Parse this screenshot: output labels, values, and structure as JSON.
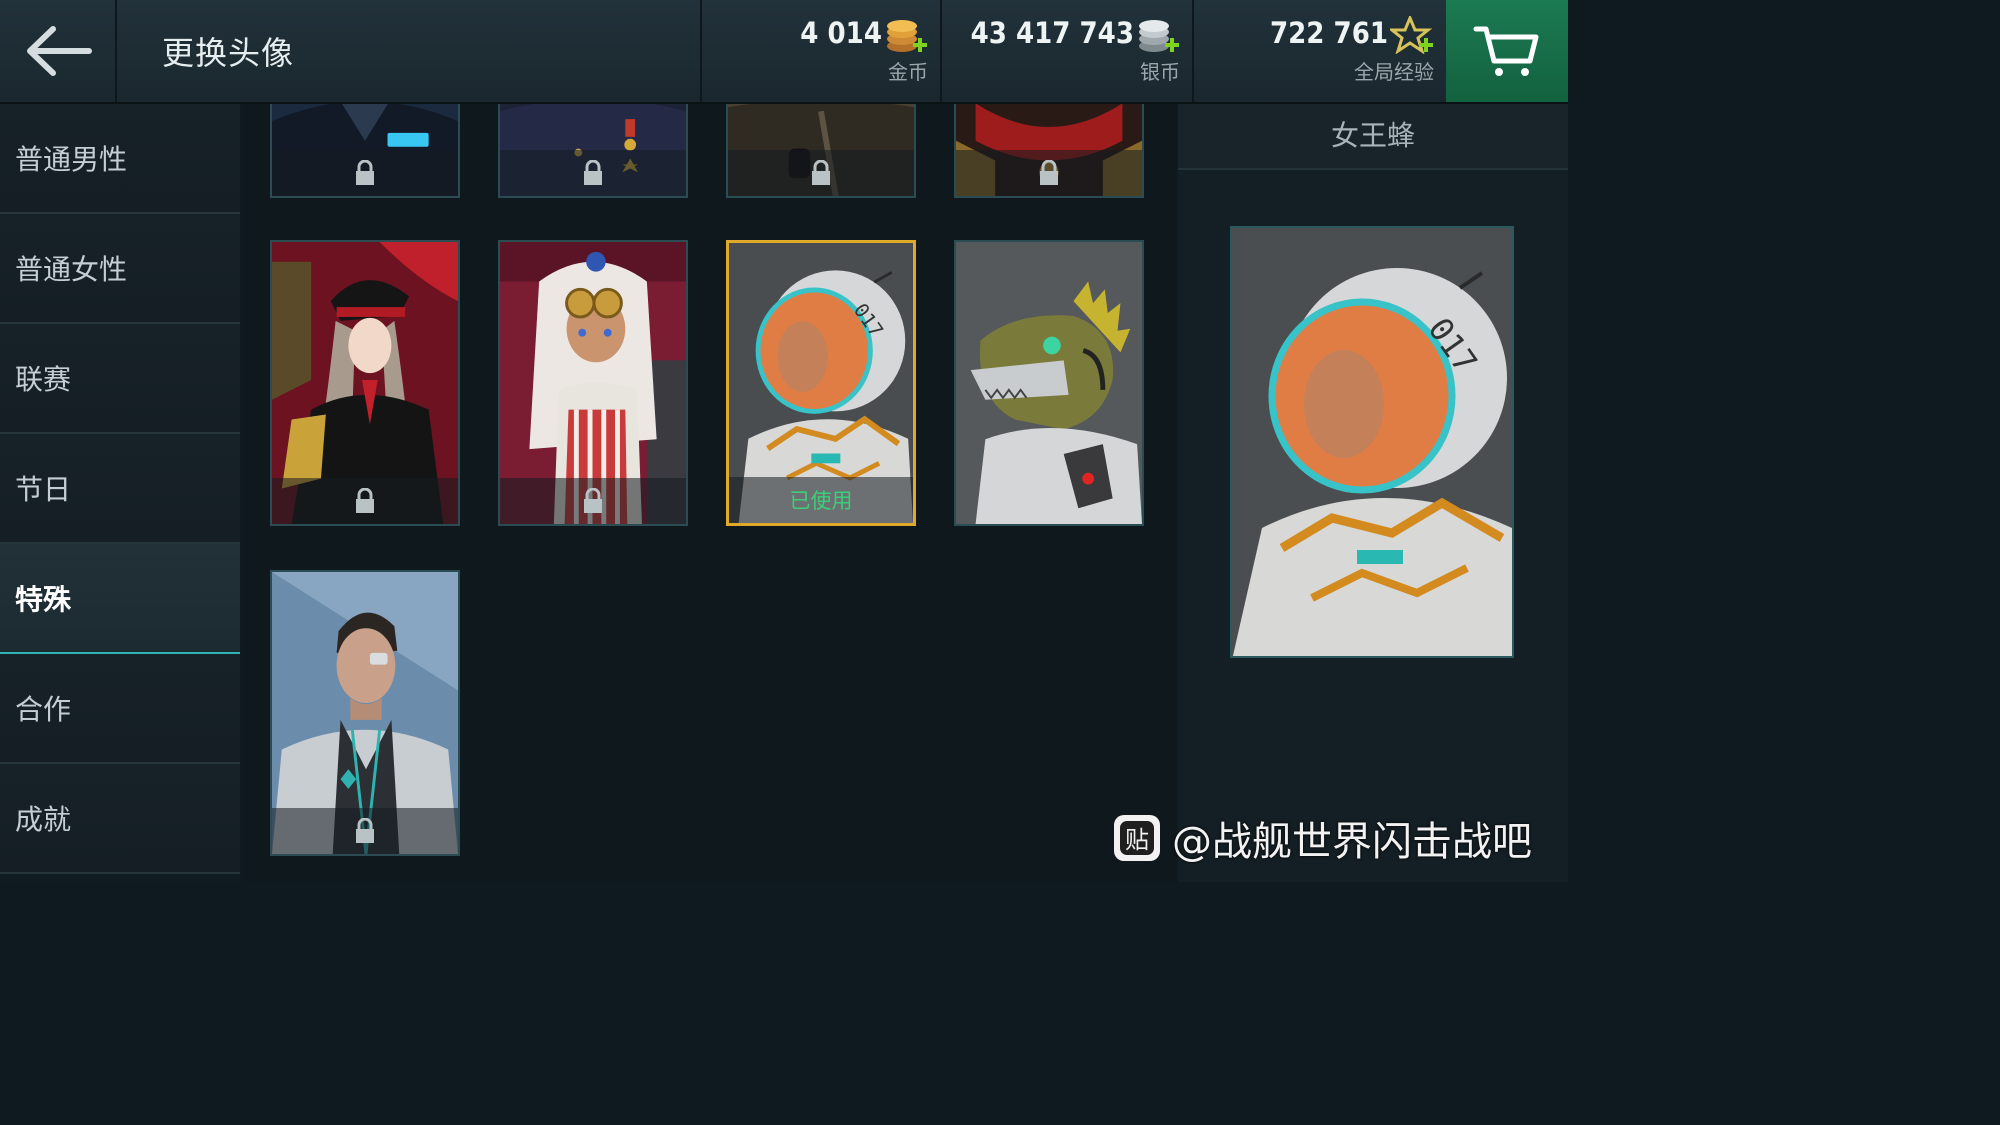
{
  "header": {
    "title": "更换头像",
    "currencies": [
      {
        "amount": "4 014",
        "label": "金币",
        "icon": "gold-coins-icon",
        "color": "#e0a13a"
      },
      {
        "amount": "43 417 743",
        "label": "银币",
        "icon": "silver-coins-icon",
        "color": "#c9d0d3"
      },
      {
        "amount": "722 761",
        "label": "全局经验",
        "icon": "star-exp-icon",
        "color": "#d8c35a"
      }
    ]
  },
  "sidebar": {
    "items": [
      {
        "label": "普通男性"
      },
      {
        "label": "普通女性"
      },
      {
        "label": "联赛"
      },
      {
        "label": "节日"
      },
      {
        "label": "特殊",
        "active": true
      },
      {
        "label": "合作"
      },
      {
        "label": "成就"
      }
    ]
  },
  "grid": {
    "used_label": "已使用",
    "tiles": [
      {
        "name": "dark-uniform-portrait",
        "locked": true
      },
      {
        "name": "medal-uniform-portrait",
        "locked": true
      },
      {
        "name": "binoculars-portrait",
        "locked": true
      },
      {
        "name": "red-gold-armor-portrait",
        "locked": true
      },
      {
        "name": "anime-officer-portrait",
        "locked": true
      },
      {
        "name": "anime-goggles-girl-portrait",
        "locked": true
      },
      {
        "name": "astronaut-woman-portrait",
        "locked": false,
        "selected": true
      },
      {
        "name": "lizard-astronaut-portrait",
        "locked": false
      },
      {
        "name": "eyepatch-officer-portrait",
        "locked": true
      }
    ]
  },
  "detail": {
    "title": "女王蜂"
  },
  "watermark": {
    "text": "@战舰世界闪击战吧"
  },
  "colors": {
    "accent": "#2fb3b1",
    "selected_border": "#e0a92a",
    "cart_green": "#1b7a52",
    "used_green": "#3ad07a"
  }
}
